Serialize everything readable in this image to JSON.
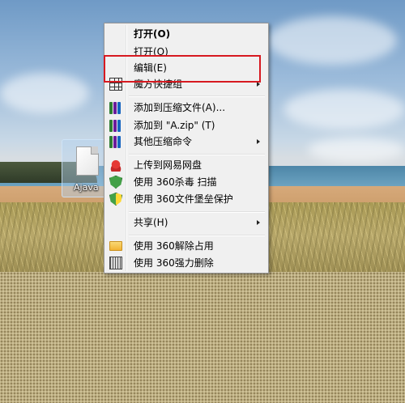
{
  "desktop": {
    "file_icon": {
      "name": "file-icon",
      "label": "Ajava"
    }
  },
  "context_menu": {
    "items": [
      {
        "label": "打开(O)",
        "bold": true,
        "icon": ""
      },
      {
        "label": "打开(O)",
        "icon": ""
      },
      {
        "label": "编辑(E)",
        "icon": "",
        "highlighted": true
      },
      {
        "label": "魔方快捷组",
        "icon": "grid-icon",
        "submenu": true
      },
      {
        "label": "添加到压缩文件(A)...",
        "icon": "winrar-books-icon"
      },
      {
        "label": "添加到 \"A.zip\" (T)",
        "icon": "winrar-books-icon"
      },
      {
        "label": "其他压缩命令",
        "icon": "winrar-books-icon",
        "submenu": true
      },
      {
        "label": "上传到网易网盘",
        "icon": "netease-cloud-icon"
      },
      {
        "label": "使用 360杀毒 扫描",
        "icon": "shield-icon"
      },
      {
        "label": "使用 360文件堡垒保护",
        "icon": "shield-icon"
      },
      {
        "label": "共享(H)",
        "icon": "",
        "submenu": true
      },
      {
        "label": "使用 360解除占用",
        "icon": "folder-icon"
      },
      {
        "label": "使用 360强力删除",
        "icon": "shredder-icon"
      }
    ]
  },
  "annotation": {
    "color": "#d71920"
  }
}
